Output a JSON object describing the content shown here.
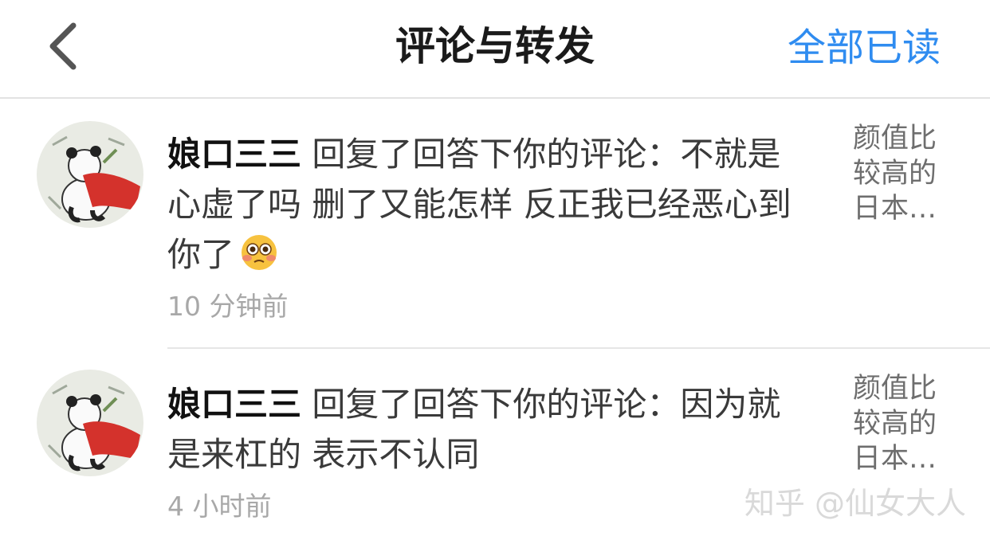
{
  "nav": {
    "title": "评论与转发",
    "mark_all_read": "全部已读",
    "back_icon": "chevron-left-icon"
  },
  "notifications": [
    {
      "user": "娘口三三",
      "action": " 回复了回答下你的评论：",
      "comment": "不就是心虚了吗 删了又能怎样 反正我已经恶心到你了",
      "emoji": "flushed-face-icon",
      "time": "10 分钟前",
      "answer_title": "颜值比较高的日本…"
    },
    {
      "user": "娘口三三",
      "action": " 回复了回答下你的评论：",
      "comment": "因为就是来杠的 表示不认同",
      "time": "4 小时前",
      "answer_title": "颜值比较高的日本…"
    }
  ],
  "watermark": "知乎 @仙女大人",
  "colors": {
    "accent": "#2f8cf0",
    "time": "#a8a8a8",
    "divider": "#e6e6e6"
  }
}
